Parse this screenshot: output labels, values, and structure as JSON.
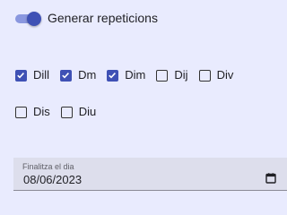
{
  "toggle": {
    "label": "Generar repeticions",
    "on": true,
    "accent": "#3f51b5"
  },
  "days": [
    {
      "label": "Dill",
      "checked": true
    },
    {
      "label": "Dm",
      "checked": true
    },
    {
      "label": "Dim",
      "checked": true
    },
    {
      "label": "Dij",
      "checked": false
    },
    {
      "label": "Div",
      "checked": false
    },
    {
      "label": "Dis",
      "checked": false
    },
    {
      "label": "Diu",
      "checked": false
    }
  ],
  "end_date": {
    "label": "Finalitza el dia",
    "value": "08/06/2023",
    "icon": "calendar-icon"
  }
}
